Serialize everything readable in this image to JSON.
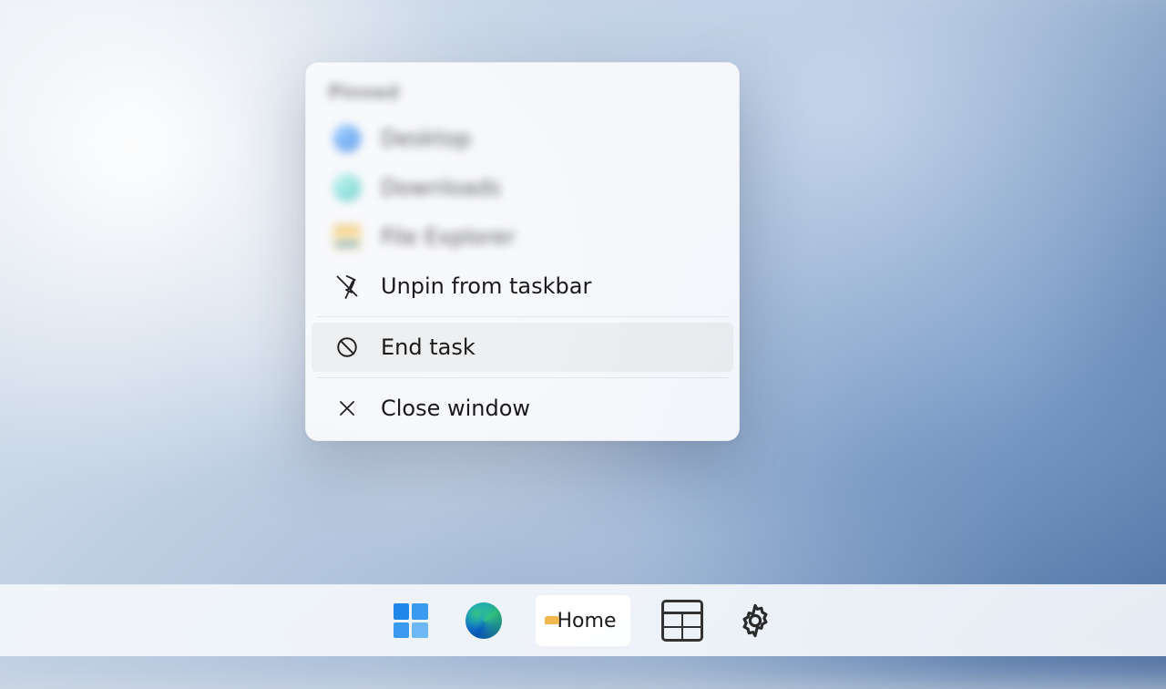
{
  "context_menu": {
    "section_title": "Pinned",
    "blurred_items": [
      {
        "icon": "dot-blue",
        "label": "Desktop"
      },
      {
        "icon": "dot-teal",
        "label": "Downloads"
      },
      {
        "icon": "folder",
        "label": "File Explorer"
      }
    ],
    "items": [
      {
        "id": "unpin",
        "icon": "unpin-icon",
        "label": "Unpin from taskbar",
        "hover": false
      },
      {
        "id": "end",
        "icon": "prohibit-icon",
        "label": "End task",
        "hover": true
      },
      {
        "id": "close",
        "icon": "close-icon",
        "label": "Close window",
        "hover": false
      }
    ]
  },
  "taskbar": {
    "start_label": "Start",
    "edge_label": "Microsoft Edge",
    "file_explorer_label": "Home",
    "calculator_label": "Calculator",
    "settings_label": "Settings"
  }
}
